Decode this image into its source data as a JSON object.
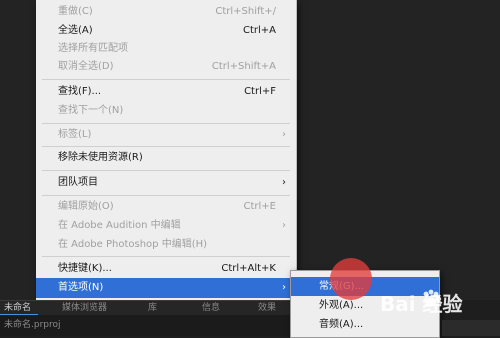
{
  "menu": {
    "items": [
      {
        "label": "重做(C)",
        "shortcut": "Ctrl+Shift+/",
        "state": "disabled"
      },
      {
        "label": "全选(A)",
        "shortcut": "Ctrl+A",
        "state": "enabled"
      },
      {
        "label": "选择所有匹配项",
        "shortcut": "",
        "state": "disabled"
      },
      {
        "label": "取消全选(D)",
        "shortcut": "Ctrl+Shift+A",
        "state": "disabled"
      },
      {
        "label": "查找(F)...",
        "shortcut": "Ctrl+F",
        "state": "enabled"
      },
      {
        "label": "查找下一个(N)",
        "shortcut": "",
        "state": "disabled"
      },
      {
        "label": "标签(L)",
        "shortcut": "",
        "state": "disabled"
      },
      {
        "label": "移除未使用资源(R)",
        "shortcut": "",
        "state": "enabled"
      },
      {
        "label": "团队项目",
        "shortcut": "",
        "state": "enabled"
      },
      {
        "label": "编辑原始(O)",
        "shortcut": "Ctrl+E",
        "state": "disabled"
      },
      {
        "label": "在 Adobe Audition 中编辑",
        "shortcut": "",
        "state": "disabled"
      },
      {
        "label": "在 Adobe Photoshop 中编辑(H)",
        "shortcut": "",
        "state": "disabled"
      },
      {
        "label": "快捷键(K)...",
        "shortcut": "Ctrl+Alt+K",
        "state": "enabled"
      },
      {
        "label": "首选项(N)",
        "shortcut": "",
        "state": "highlighted"
      }
    ]
  },
  "submenu": {
    "items": [
      {
        "label": "常规(G)..."
      },
      {
        "label": "外观(A)..."
      },
      {
        "label": "音频(A)..."
      }
    ]
  },
  "panel": {
    "tabs": [
      "未命名",
      "媒体浏览器",
      "库",
      "信息",
      "效果"
    ],
    "project_file": "未命名.prproj"
  },
  "watermark": {
    "text": "Bai 经验"
  }
}
